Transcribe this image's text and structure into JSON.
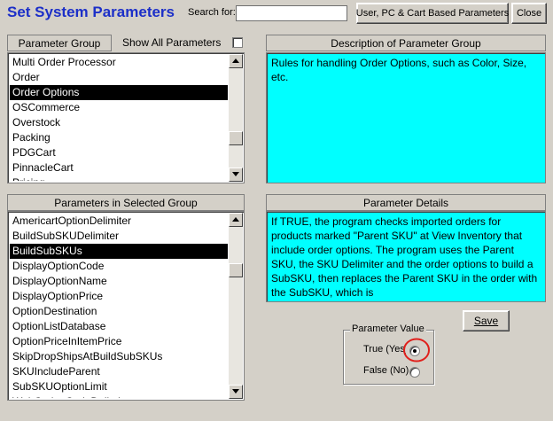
{
  "header": {
    "title": "Set System Parameters",
    "search_label": "Search for:",
    "search_value": "",
    "user_pc_button": "User, PC & Cart Based Parameters",
    "close_button": "Close"
  },
  "parameter_group": {
    "header": "Parameter Group",
    "show_all_label": "Show All Parameters",
    "show_all_checked": false,
    "items": [
      "Multi Order Processor",
      "Order",
      "Order Options",
      "OSCommerce",
      "Overstock",
      "Packing",
      "PDGCart",
      "PinnacleCart",
      "Pricing"
    ],
    "selected": "Order Options"
  },
  "description": {
    "header": "Description of Parameter Group",
    "text": "Rules for handling Order Options, such as Color, Size, etc."
  },
  "parameters": {
    "header": "Parameters in Selected Group",
    "items": [
      "AmericartOptionDelimiter",
      "BuildSubSKUDelimiter",
      "BuildSubSKUs",
      "DisplayOptionCode",
      "DisplayOptionName",
      "DisplayOptionPrice",
      "OptionDestination",
      "OptionListDatabase",
      "OptionPriceInItemPrice",
      "SkipDropShipsAtBuildSubSKUs",
      "SKUIncludeParent",
      "SubSKUOptionLimit",
      "WebOptionCodeDelimiter"
    ],
    "selected": "BuildSubSKUs"
  },
  "details": {
    "header": "Parameter Details",
    "text": "If TRUE, the program checks imported orders for products marked \"Parent SKU\" at View Inventory that include order options. The program uses the Parent SKU, the SKU Delimiter and the order options to build a SubSKU, then replaces the Parent SKU in the order with the SubSKU, which is"
  },
  "parameter_value": {
    "legend": "Parameter Value",
    "true_label": "True (Yes)",
    "false_label": "False (No)",
    "selected": "true",
    "highlight_color": "#e0201c"
  },
  "save_button": "Save",
  "colors": {
    "title": "#1c2fc8",
    "cyan_panel": "#00ffff",
    "window_bg": "#d4d0c8",
    "selection": "#000000"
  }
}
